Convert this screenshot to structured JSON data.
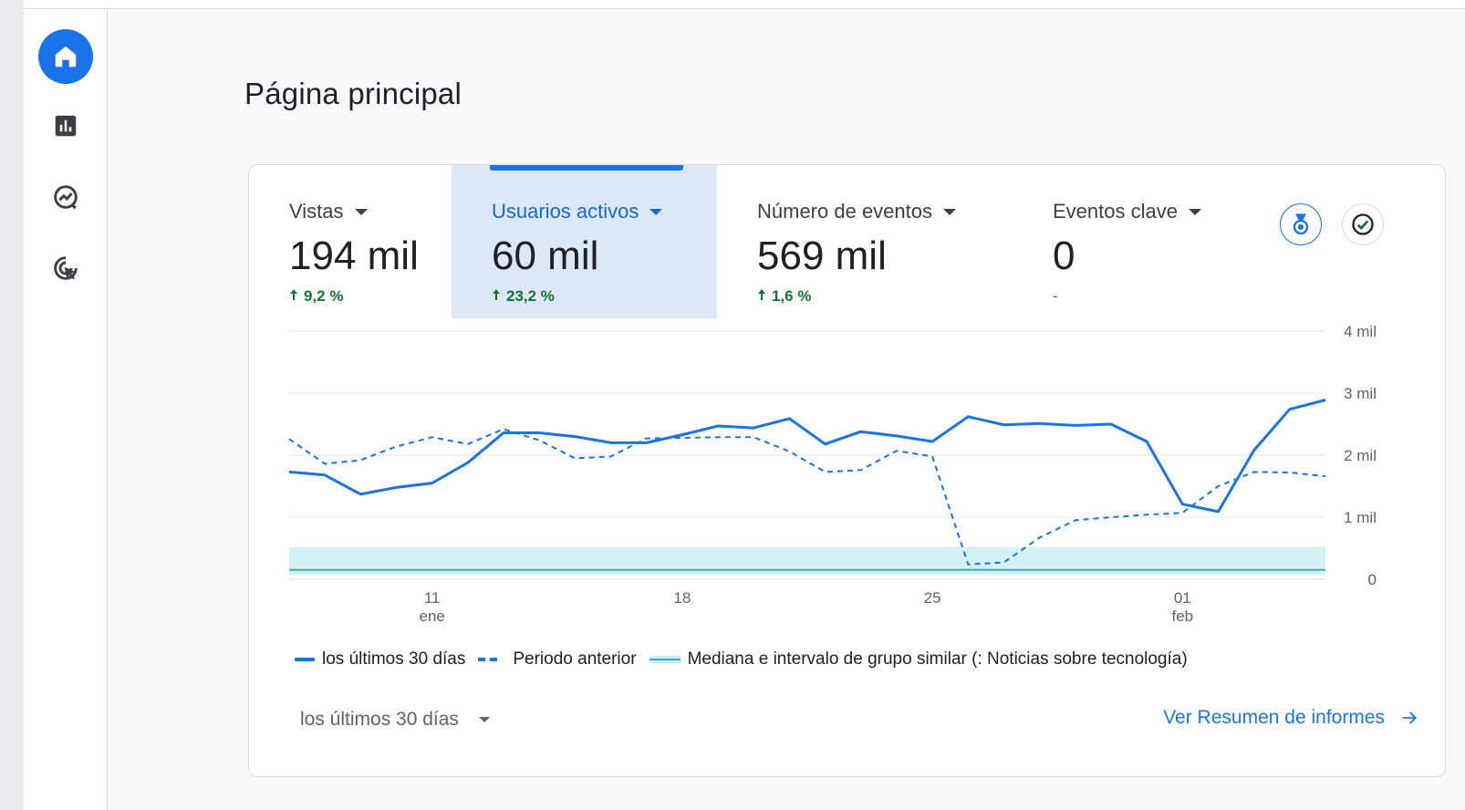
{
  "page": {
    "title": "Página principal"
  },
  "nav": {
    "items": [
      {
        "icon": "home-icon",
        "active": true
      },
      {
        "icon": "reports-icon",
        "active": false
      },
      {
        "icon": "explore-icon",
        "active": false
      },
      {
        "icon": "advertising-icon",
        "active": false
      }
    ]
  },
  "metrics": [
    {
      "label": "Vistas",
      "value": "194 mil",
      "change": "9,2 %",
      "trend": "up"
    },
    {
      "label": "Usuarios activos",
      "value": "60 mil",
      "change": "23,2 %",
      "trend": "up",
      "selected": true
    },
    {
      "label": "Número de eventos",
      "value": "569 mil",
      "change": "1,6 %",
      "trend": "up"
    },
    {
      "label": "Eventos clave",
      "value": "0",
      "change": "-",
      "trend": "none"
    }
  ],
  "colors": {
    "accent": "#1a73e8",
    "positive": "#137333",
    "selected_bg": "#dce7f8",
    "band": "#cdeff3",
    "median": "#2bb3b7"
  },
  "chart_data": {
    "type": "line",
    "x_tick_labels": [
      {
        "day": "11",
        "month": "ene",
        "index": 4
      },
      {
        "day": "18",
        "month": "",
        "index": 11
      },
      {
        "day": "25",
        "month": "",
        "index": 18
      },
      {
        "day": "01",
        "month": "feb",
        "index": 25
      }
    ],
    "y_tick_labels": [
      "0",
      "1 mil",
      "2 mil",
      "3 mil",
      "4 mil"
    ],
    "ylim": [
      0,
      4000
    ],
    "grid": true,
    "series": [
      {
        "name": "los últimos 30 días",
        "style": "solid",
        "values": [
          1730,
          1680,
          1370,
          1480,
          1550,
          1880,
          2360,
          2360,
          2300,
          2200,
          2200,
          2330,
          2470,
          2440,
          2590,
          2180,
          2380,
          2310,
          2220,
          2620,
          2490,
          2510,
          2480,
          2500,
          2220,
          1210,
          1090,
          2080,
          2740,
          2890
        ]
      },
      {
        "name": "Periodo anterior",
        "style": "dashed",
        "values": [
          2260,
          1860,
          1920,
          2140,
          2290,
          2180,
          2420,
          2240,
          1950,
          1980,
          2270,
          2280,
          2290,
          2290,
          2060,
          1730,
          1760,
          2070,
          1980,
          240,
          270,
          670,
          950,
          1000,
          1040,
          1070,
          1500,
          1730,
          1720,
          1660
        ]
      },
      {
        "name": "Mediana e intervalo de grupo similar (: Noticias sobre tecnología)",
        "style": "band",
        "median": 150,
        "band_low": 70,
        "band_high": 520
      }
    ]
  },
  "legend": {
    "current": "los últimos 30 días",
    "previous": "Periodo anterior",
    "peer": "Mediana e intervalo de grupo similar (: Noticias sobre tecnología)"
  },
  "footer": {
    "date_range": "los últimos 30 días",
    "link": "Ver Resumen de informes"
  }
}
